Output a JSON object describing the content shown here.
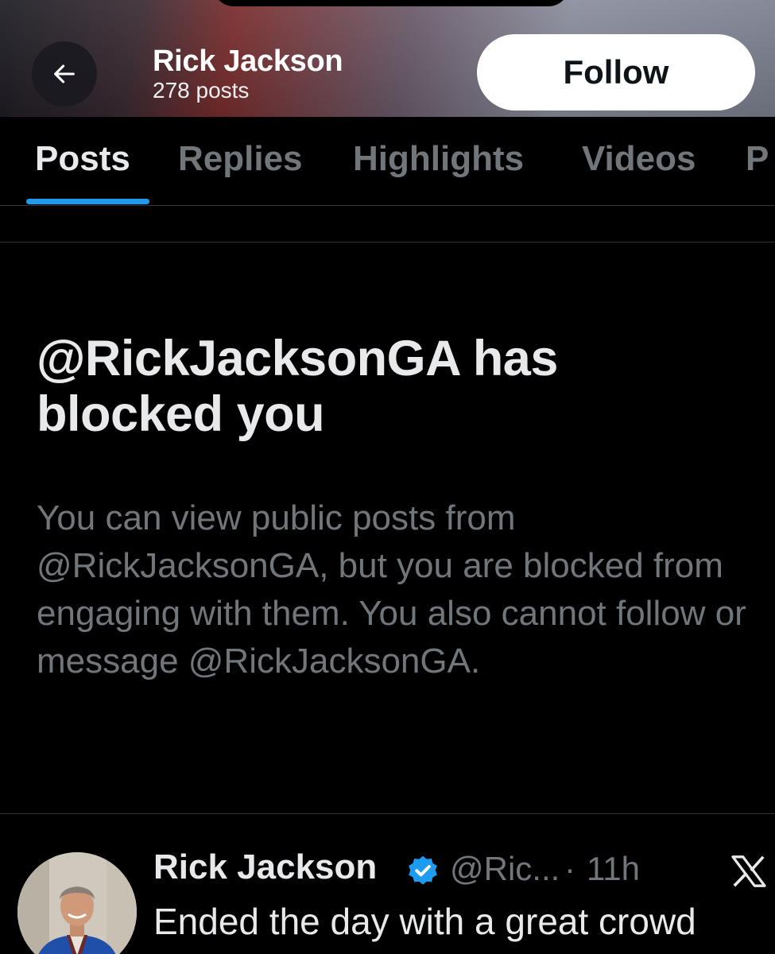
{
  "header": {
    "back_icon": "arrow-left-icon",
    "name": "Rick Jackson",
    "post_count": "278 posts",
    "follow_label": "Follow"
  },
  "tabs": [
    {
      "label": "Posts",
      "active": true
    },
    {
      "label": "Replies",
      "active": false
    },
    {
      "label": "Highlights",
      "active": false
    },
    {
      "label": "Videos",
      "active": false
    },
    {
      "label": "P",
      "active": false
    }
  ],
  "blocked": {
    "title": "@RickJacksonGA has blocked you",
    "description": "You can view public posts from @RickJacksonGA, but you are blocked from engaging with them. You also cannot follow or message @RickJacksonGA."
  },
  "post": {
    "name": "Rick Jackson",
    "verified_icon": "verified-badge-icon",
    "handle": "@Ric...",
    "separator": "·",
    "time": "11h",
    "text": "Ended the day with a great crowd",
    "more_icon": "x-logo-icon"
  },
  "colors": {
    "background": "#000000",
    "accent": "#1d9bf0",
    "primary_text": "#e7e9ea",
    "secondary_text": "#71767b"
  }
}
